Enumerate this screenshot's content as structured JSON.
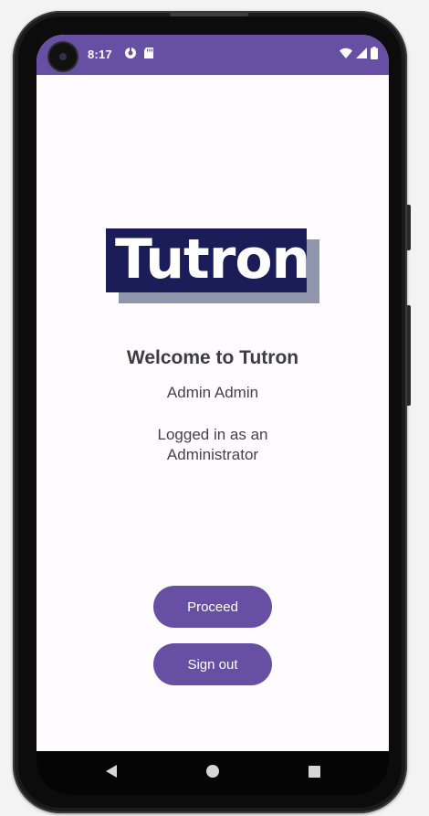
{
  "status_bar": {
    "time": "8:17",
    "icons_left": [
      "privacy-indicator-icon",
      "sd-card-icon"
    ],
    "icons_right": [
      "wifi-icon",
      "signal-icon",
      "battery-icon"
    ],
    "background_color": "#6750a4"
  },
  "logo": {
    "text": "Tutron",
    "colors": {
      "box": "#1a1d58",
      "shadow": "#8e95ad",
      "text": "#ffffff"
    }
  },
  "welcome": {
    "title": "Welcome to Tutron",
    "user_name": "Admin Admin",
    "role_text": "Logged in as an Administrator"
  },
  "buttons": {
    "proceed_label": "Proceed",
    "sign_out_label": "Sign out",
    "color": "#6750a4"
  },
  "nav_bar": {
    "icons": [
      "back-icon",
      "home-icon",
      "recents-icon"
    ]
  }
}
